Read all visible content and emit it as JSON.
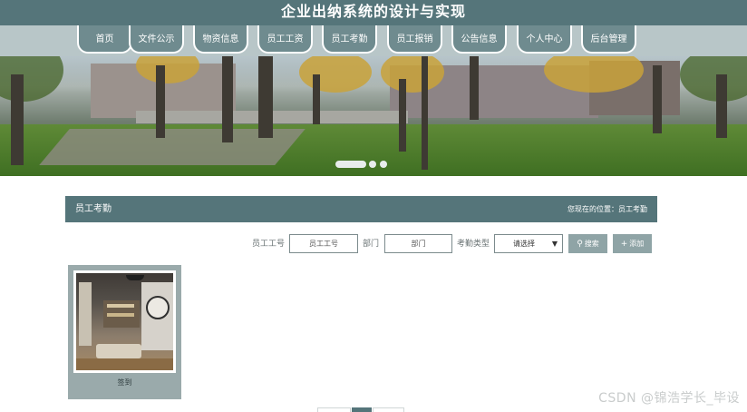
{
  "site_title": "企业出纳系统的设计与实现",
  "nav": [
    {
      "label": "首页"
    },
    {
      "label": "文件公示"
    },
    {
      "label": "物资信息"
    },
    {
      "label": "员工工资"
    },
    {
      "label": "员工考勤"
    },
    {
      "label": "员工报销"
    },
    {
      "label": "公告信息"
    },
    {
      "label": "个人中心"
    },
    {
      "label": "后台管理"
    }
  ],
  "banner": {
    "active_slide": 1,
    "slide_count": 3
  },
  "section": {
    "title": "员工考勤",
    "breadcrumb": "您现在的位置：员工考勤"
  },
  "search": {
    "employee_no_label": "员工工号",
    "employee_no_placeholder": "员工工号",
    "department_label": "部门",
    "department_placeholder": "部门",
    "type_label": "考勤类型",
    "type_selected": "请选择",
    "search_button": "搜索",
    "add_button": "添加"
  },
  "cards": [
    {
      "label": "签到"
    }
  ],
  "watermark": "CSDN @锦浩学长_毕设",
  "colors": {
    "primary": "#55757a",
    "nav_tab": "#6f8b8f",
    "nav_bg": "#b8c6c8",
    "button": "#8fa4a6"
  }
}
